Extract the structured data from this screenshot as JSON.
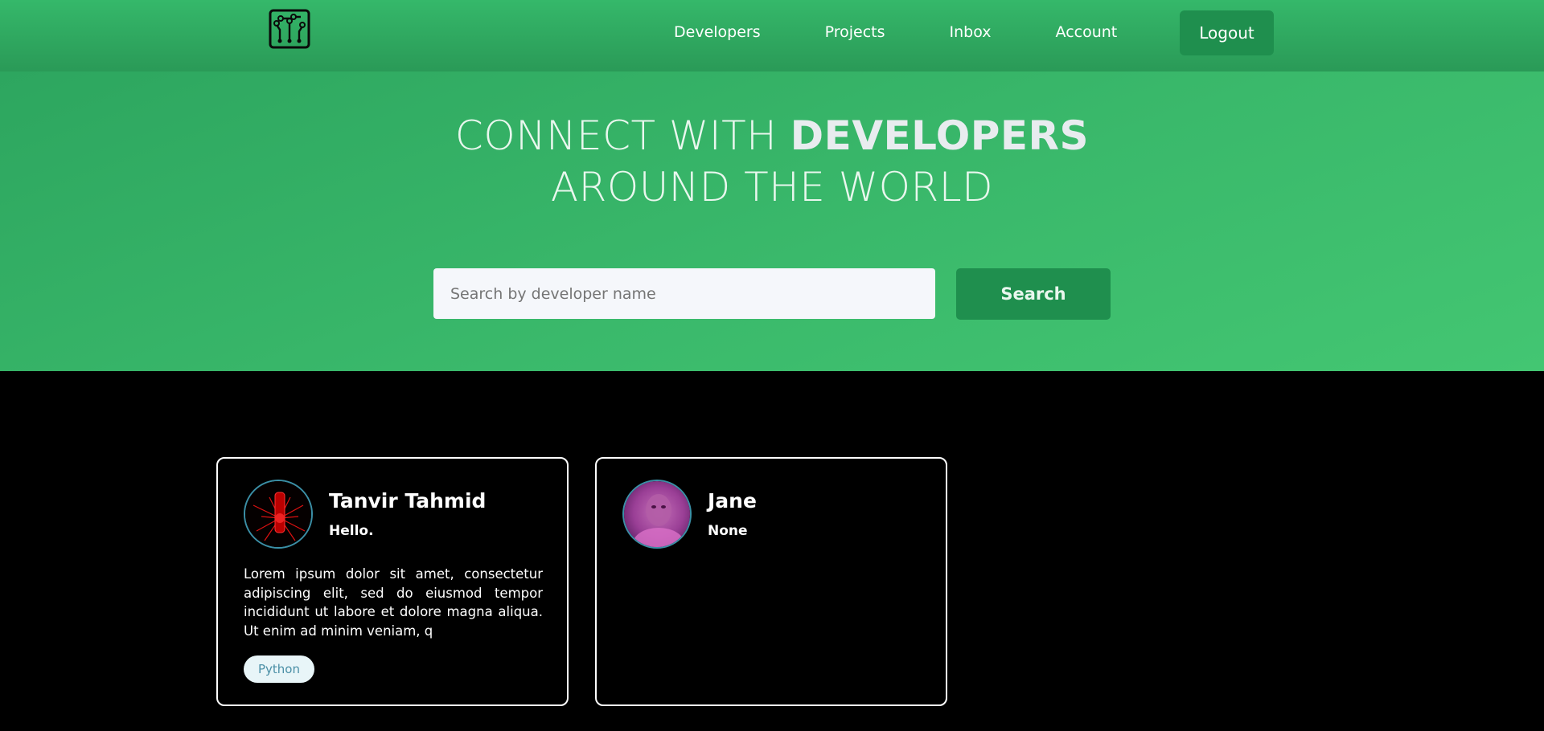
{
  "nav": {
    "logo_icon": "circuit-board-icon",
    "links": [
      "Developers",
      "Projects",
      "Inbox",
      "Account"
    ],
    "logout_label": "Logout"
  },
  "hero": {
    "title_light": "CONNECT WITH ",
    "title_bold": "DEVELOPERS",
    "title_line2": "AROUND THE WORLD",
    "search_placeholder": "Search by developer name",
    "search_button": "Search"
  },
  "colors": {
    "brand_green": "#3ab96b",
    "button_green": "#1f8f4e",
    "card_border": "#ffffff",
    "tag_text": "#4a8fa6"
  },
  "developers": [
    {
      "name": "Tanvir Tahmid",
      "headline": "Hello.",
      "bio": "Lorem ipsum dolor sit amet, consectetur adipiscing elit, sed do eiusmod tempor incididunt ut labore et dolore magna aliqua. Ut enim ad minim veniam, q",
      "skills": [
        "Python"
      ],
      "avatar_icon": "red-figure-avatar"
    },
    {
      "name": "Jane",
      "headline": "None",
      "bio": "",
      "skills": [],
      "avatar_icon": "purple-portrait-avatar"
    }
  ]
}
